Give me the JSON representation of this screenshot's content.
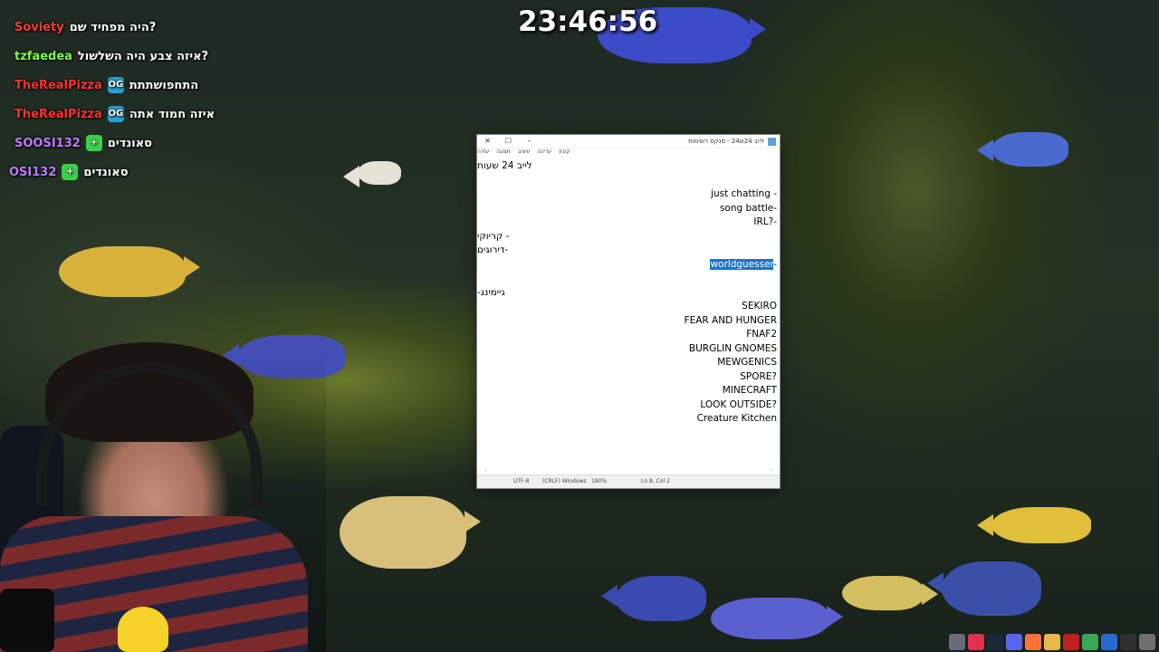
{
  "stream": {
    "clock": "23:46:56"
  },
  "chat": {
    "messages": [
      {
        "user": "Soviety",
        "user_color": "#ff3b3b",
        "text": "היה מפחיד שם?",
        "badge": ""
      },
      {
        "user": "tzfaedea",
        "user_color": "#7cff4a",
        "text": "איזה צבע היה השלשול?",
        "badge": ""
      },
      {
        "user": "TheRealPizza",
        "user_color": "#ff3030",
        "text": "התחפושתתת",
        "badge": "OG"
      },
      {
        "user": "TheRealPizza",
        "user_color": "#ff3030",
        "text": "איזה חמוד אתה",
        "badge": "OG"
      },
      {
        "user": "SOOSI132",
        "user_color": "#c07aff",
        "text": "סאונדים",
        "badge": "+"
      },
      {
        "user": "OSI132",
        "user_color": "#c07aff",
        "text": "סאונדים",
        "badge": "+"
      }
    ]
  },
  "notepad": {
    "title": "לייב 24ש24 - פנקס רשימות",
    "controls": {
      "close": "✕",
      "maximize": "☐",
      "minimize": "–"
    },
    "menu": [
      "קובץ",
      "עריכה",
      "עיצוב",
      "תצוגה",
      "עזרה"
    ],
    "lines": [
      "לייב 24 שעות",
      "",
      "just chatting -",
      "song battle-",
      "IRL?-",
      "- קריוקי",
      "-דירוגים",
      "worldguesser-",
      "",
      "גיימינג-",
      "SEKIRO",
      "FEAR AND HUNGER",
      "FNAF2",
      "BURGLIN GNOMES",
      "MEWGENICS",
      "SPORE?",
      "MINECRAFT",
      "LOOK OUTSIDE?",
      "Creature Kitchen"
    ],
    "selected_line_index": 7,
    "selected_text": "worldguesser",
    "selected_suffix": "-",
    "status": {
      "encoding": "UTF-8",
      "line_endings": "(CRLF) Windows",
      "zoom": "180%",
      "position": "Ln 8, Col 2"
    }
  },
  "taskbar": {
    "icons": [
      {
        "name": "pinned-app",
        "color": "#6a6a7a"
      },
      {
        "name": "media-player",
        "color": "#e03050"
      },
      {
        "name": "steam",
        "color": "#1b2838"
      },
      {
        "name": "discord",
        "color": "#5865f2"
      },
      {
        "name": "firefox",
        "color": "#ff7139"
      },
      {
        "name": "folder",
        "color": "#e8b84a"
      },
      {
        "name": "record",
        "color": "#c02020"
      },
      {
        "name": "chrome",
        "color": "#3aa757"
      },
      {
        "name": "app-blue",
        "color": "#2a6ad0"
      },
      {
        "name": "app-dark",
        "color": "#303030"
      },
      {
        "name": "app-gray",
        "color": "#707070"
      }
    ]
  }
}
